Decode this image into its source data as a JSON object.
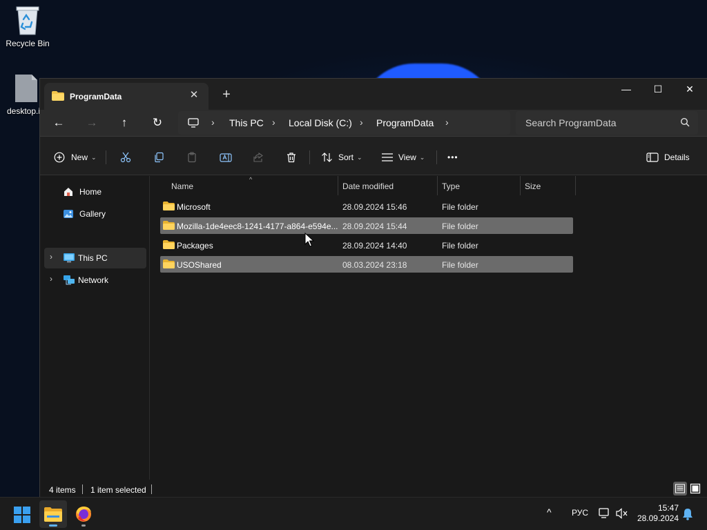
{
  "desktop": {
    "icons": [
      {
        "label": "Recycle Bin",
        "icon": "recycle-bin-icon"
      },
      {
        "label": "desktop.i",
        "icon": "settings-file-icon"
      }
    ]
  },
  "window": {
    "tab_title": "ProgramData",
    "tab_close_glyph": "✕",
    "new_tab_glyph": "+",
    "controls": {
      "minimize": "—",
      "maximize": "☐",
      "close": "✕"
    },
    "nav": {
      "back": "←",
      "forward": "→",
      "up": "↑",
      "refresh": "↻"
    },
    "breadcrumb": [
      "This PC",
      "Local Disk (C:)",
      "ProgramData"
    ],
    "breadcrumb_sep": "›",
    "search_placeholder": "Search ProgramData",
    "toolbar": {
      "new_label": "New",
      "sort_label": "Sort",
      "view_label": "View",
      "more_label": "•••",
      "details_label": "Details",
      "caret": "⌄"
    },
    "navpane": {
      "items": [
        {
          "label": "Home",
          "icon": "home-icon"
        },
        {
          "label": "Gallery",
          "icon": "gallery-icon"
        },
        {
          "label": "This PC",
          "icon": "this-pc-icon",
          "expand": "›",
          "selected": true
        },
        {
          "label": "Network",
          "icon": "network-icon",
          "expand": "›"
        }
      ]
    },
    "columns": {
      "name": "Name",
      "date": "Date modified",
      "type": "Type",
      "size": "Size",
      "sort_glyph": "^"
    },
    "rows": [
      {
        "name": "Microsoft",
        "date": "28.09.2024 15:46",
        "type": "File folder",
        "selected": false
      },
      {
        "name": "Mozilla-1de4eec8-1241-4177-a864-e594e...",
        "date": "28.09.2024 15:44",
        "type": "File folder",
        "selected": true
      },
      {
        "name": "Packages",
        "date": "28.09.2024 14:40",
        "type": "File folder",
        "selected": false
      },
      {
        "name": "USOShared",
        "date": "08.03.2024 23:18",
        "type": "File folder",
        "selected": true
      }
    ],
    "status": {
      "items": "4 items",
      "selected": "1 item selected"
    }
  },
  "taskbar": {
    "apps": [
      {
        "name": "start-button",
        "icon": "windows-logo-icon"
      },
      {
        "name": "file-explorer",
        "icon": "file-explorer-icon",
        "active": true
      },
      {
        "name": "firefox",
        "icon": "firefox-icon"
      }
    ],
    "tray": {
      "chevron": "^",
      "language": "РУС"
    },
    "clock": {
      "time": "15:47",
      "date": "28.09.2024"
    }
  },
  "colors": {
    "accent": "#5fb2f2",
    "folder": "#f4c54a",
    "window_bg": "#191919",
    "selection": "#6b6b6b"
  }
}
